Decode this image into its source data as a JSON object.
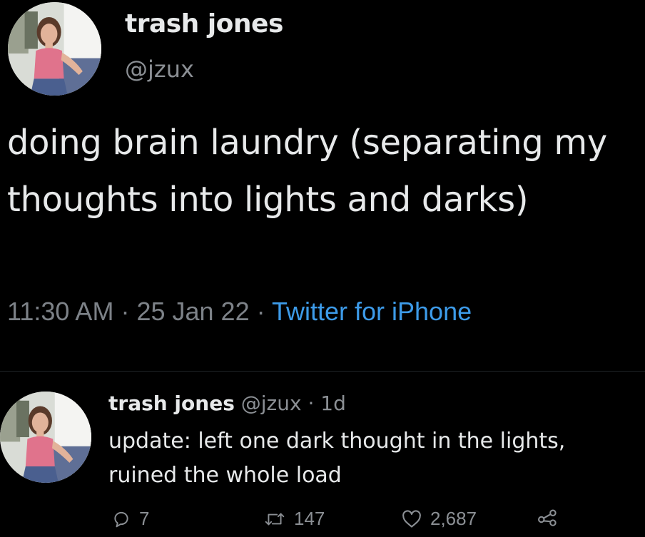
{
  "tweet": {
    "author_name": "trash jones",
    "author_handle": "@jzux",
    "text": "doing brain laundry (separating my thoughts into lights and darks)",
    "time": "11:30 AM",
    "sep1": "·",
    "date": "25 Jan 22",
    "sep2": "·",
    "source": "Twitter for iPhone"
  },
  "reply": {
    "author_name": "trash jones",
    "author_handle": "@jzux",
    "separator": "·",
    "age": "1d",
    "text": "update: left one dark thought in the lights, ruined the whole load",
    "actions": {
      "replies": "7",
      "retweets": "147",
      "likes": "2,687"
    }
  },
  "icons": {
    "reply": "speech-bubble-icon",
    "retweet": "retweet-icon",
    "like": "heart-icon",
    "share": "share-icon"
  },
  "colors": {
    "background": "#000000",
    "text": "#e7e9ea",
    "muted": "#8b8f94",
    "link": "#3d9be9"
  }
}
